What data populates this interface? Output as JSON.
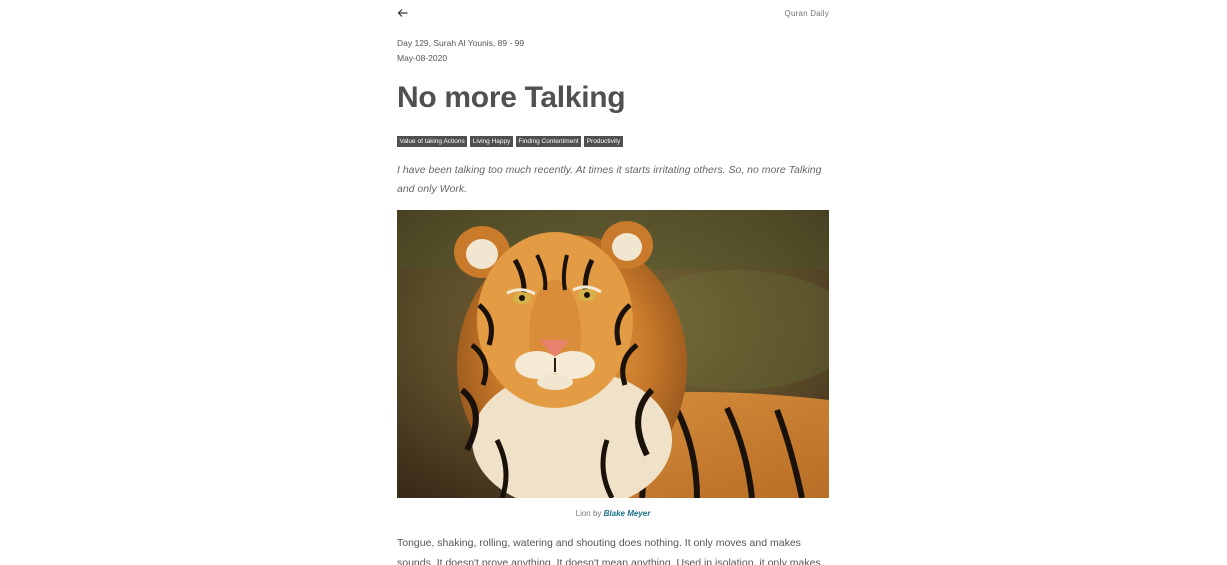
{
  "header": {
    "back_icon": "arrow-left-icon",
    "site_name": "Quran Daily"
  },
  "post": {
    "day_line": "Day 129, Surah Al Younis, 89 - 99",
    "date": "May-08-2020",
    "title": "No more Talking",
    "tags": [
      "Value of taking Actions",
      "Living Happy",
      "Finding Contentment",
      "Productivity"
    ],
    "lead": "I have been talking too much recently. At times it starts irritating others. So, no more Talking and only Work.",
    "image": {
      "subject": "tiger portrait photo"
    },
    "caption_prefix": "Lion by",
    "caption_author": "Blake Meyer",
    "body": "Tongue, shaking, rolling, watering and shouting does nothing. It only moves and makes sounds. It doesn't prove anything. It doesn't mean anything. Used in isolation, it only makes"
  },
  "colors": {
    "tag_bg": "#4f4f4f",
    "link": "#1a6f88",
    "title": "#505050"
  }
}
